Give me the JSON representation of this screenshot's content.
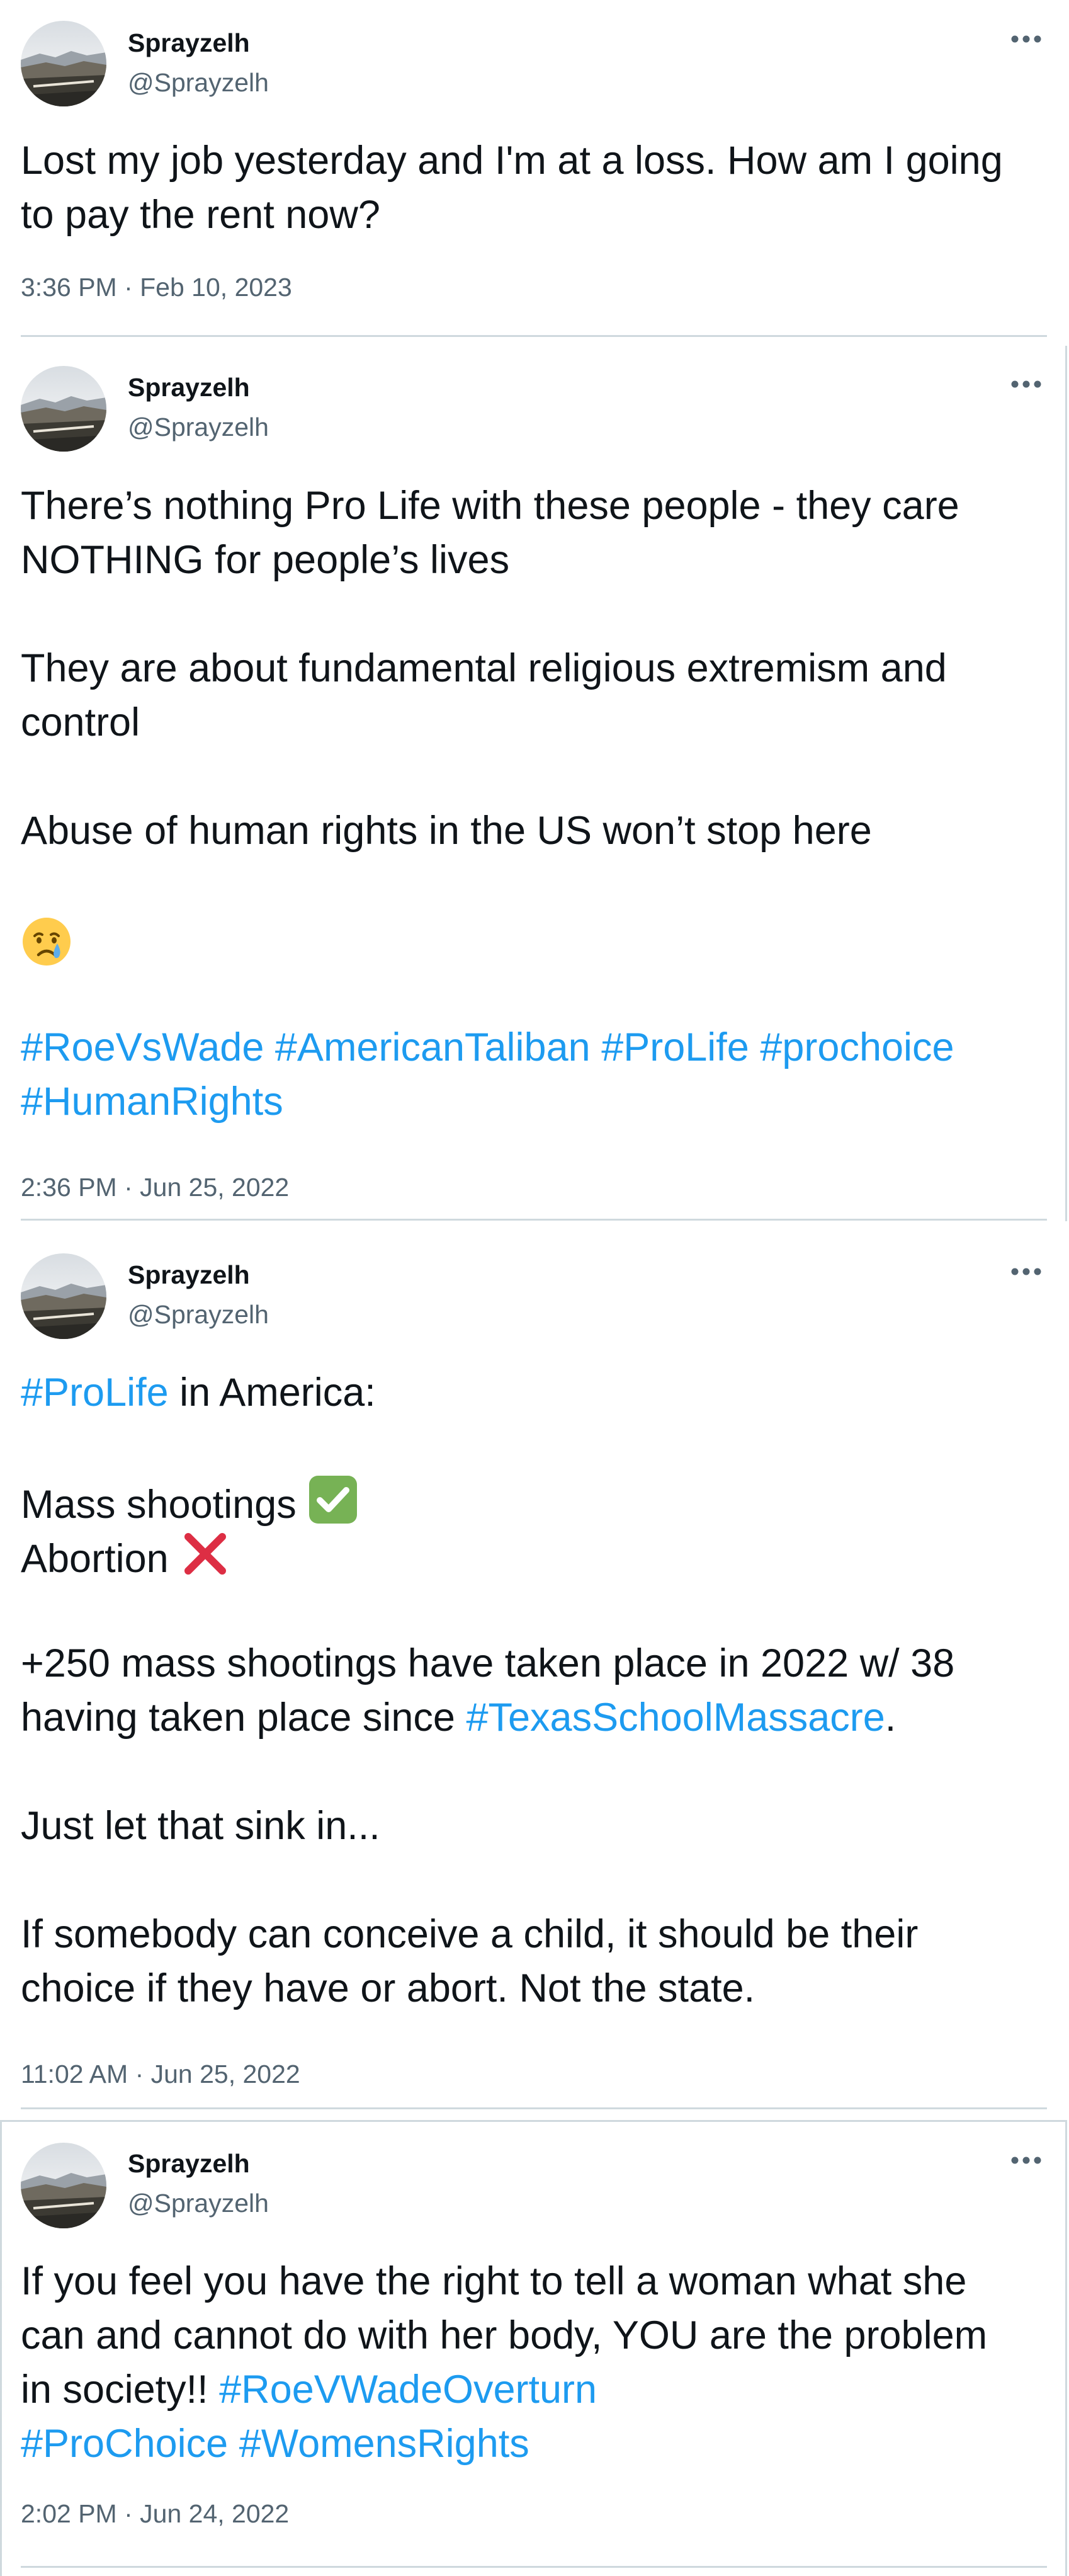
{
  "tweets": [
    {
      "display_name": "Sprayzelh",
      "handle": "@Sprayzelh",
      "lines": [
        "Lost my job yesterday and I'm at a loss. How am I going",
        "to pay the rent now?"
      ],
      "time": "3:36 PM",
      "date": "Feb 10, 2023"
    },
    {
      "display_name": "Sprayzelh",
      "handle": "@Sprayzelh",
      "lines": [
        "There’s nothing Pro Life with these people - they care",
        "NOTHING for people’s lives",
        "They are about fundamental religious extremism and",
        "control",
        "Abuse of human rights in the US won’t stop here"
      ],
      "emoji": "crying-face",
      "hashtags_line1": [
        "#RoeVsWade",
        "#AmericanTaliban",
        "#ProLife",
        "#prochoice"
      ],
      "hashtags_line2": [
        "#HumanRights"
      ],
      "time": "2:36 PM",
      "date": "Jun 25, 2022"
    },
    {
      "display_name": "Sprayzelh",
      "handle": "@Sprayzelh",
      "intro_tag": "#ProLife",
      "intro_text": " in America:",
      "shootings_text": "Mass shootings ",
      "shootings_mark": "check-mark",
      "abortion_text": "Abortion ",
      "abortion_mark": "cross-mark",
      "stat_line1": "+250 mass shootings have taken place in 2022 w/ 38",
      "stat_line2_text": "having taken place since ",
      "stat_line2_tag": "#TexasSchoolMassacre",
      "stat_line2_end": ".",
      "sink_line": "Just let that sink in...",
      "closing_line1": "If somebody can conceive a child, it should be their",
      "closing_line2": "choice if they have or abort. Not the state.",
      "time": "11:02 AM",
      "date": "Jun 25, 2022"
    },
    {
      "display_name": "Sprayzelh",
      "handle": "@Sprayzelh",
      "line1": "If you feel you have the right to tell a woman what she",
      "line2": "can and cannot do with her body, YOU are the problem",
      "line3_text": "in society!! ",
      "line3_tag": "#RoeVWadeOverturn",
      "line4_tags": [
        "#ProChoice",
        "#WomensRights"
      ],
      "time": "2:02 PM",
      "date": "Jun 24, 2022"
    }
  ],
  "meta_separator": " · ",
  "colors": {
    "text": "#0f1419",
    "secondary": "#536471",
    "link": "#1d9bf0",
    "divider": "#cfd9de"
  }
}
